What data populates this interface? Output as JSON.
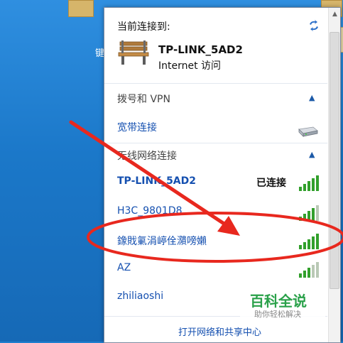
{
  "desktop": {
    "icon_text": "键"
  },
  "panel": {
    "current_label": "当前连接到:",
    "current_network": {
      "name": "TP-LINK_5AD2",
      "status": "Internet 访问"
    },
    "sections": {
      "dialup": {
        "label": "拨号和 VPN",
        "items": [
          "宽带连接"
        ]
      },
      "wireless": {
        "label": "无线网络连接",
        "networks": [
          {
            "name": "TP-LINK_5AD2",
            "status": "已连接",
            "signal": 5
          },
          {
            "name": "H3C_9801D8",
            "status": "",
            "signal": 4
          },
          {
            "name": "鐌戝氭涓嵉佺濻嗙嬾",
            "status": "",
            "signal": 5
          },
          {
            "name": "AZ",
            "status": "",
            "signal": 3
          },
          {
            "name": "zhiliaoshi",
            "status": "",
            "signal": 0
          }
        ]
      }
    },
    "footer_link": "打开网络和共享中心"
  },
  "watermark": {
    "title": "百科全说",
    "subtitle": "助你轻松解决"
  },
  "annotation": {
    "arrow_color": "#e8281e",
    "ellipse_color": "#e8281e"
  }
}
